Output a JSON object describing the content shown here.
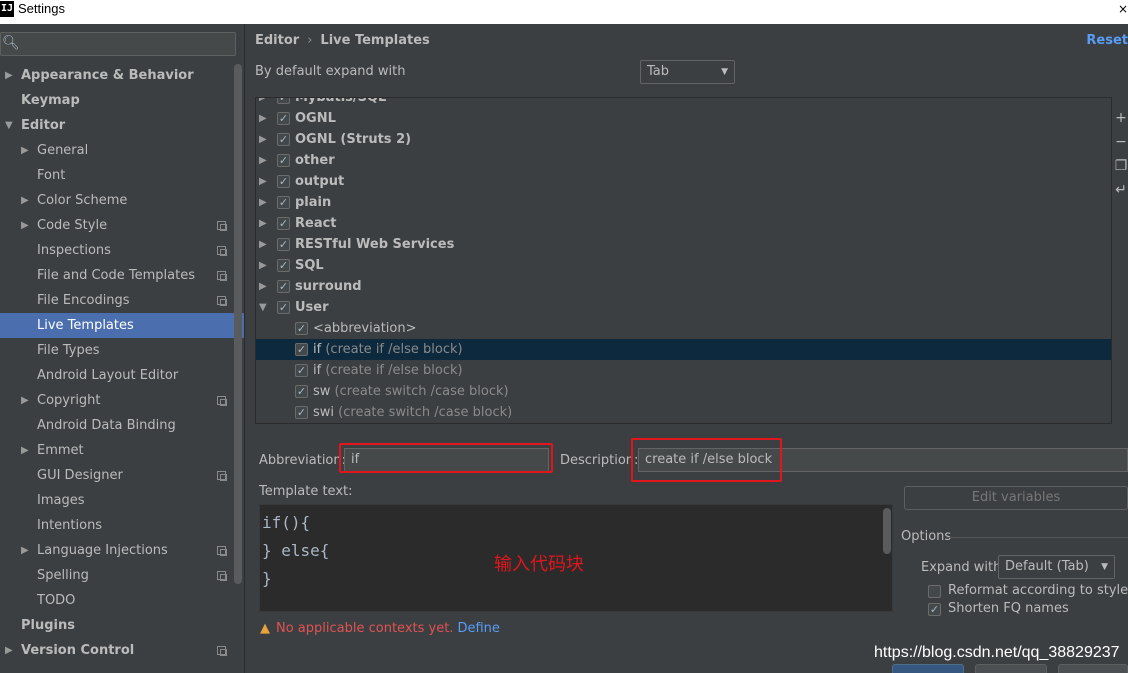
{
  "window": {
    "app_icon": "IJ",
    "title": "Settings",
    "close": "×"
  },
  "search": {
    "placeholder": "",
    "icon": "search-icon"
  },
  "sidebar": {
    "items": [
      {
        "label": "Appearance & Behavior",
        "bold": true,
        "arrow": "▶"
      },
      {
        "label": "Keymap",
        "bold": true,
        "arrow": ""
      },
      {
        "label": "Editor",
        "bold": true,
        "arrow": "▼"
      },
      {
        "label": "General",
        "arrow": "▶"
      },
      {
        "label": "Font",
        "arrow": ""
      },
      {
        "label": "Color Scheme",
        "arrow": "▶"
      },
      {
        "label": "Code Style",
        "arrow": "▶",
        "project": true
      },
      {
        "label": "Inspections",
        "arrow": "",
        "project": true
      },
      {
        "label": "File and Code Templates",
        "arrow": "",
        "project": true
      },
      {
        "label": "File Encodings",
        "arrow": "",
        "project": true
      },
      {
        "label": "Live Templates",
        "arrow": "",
        "selected": true
      },
      {
        "label": "File Types",
        "arrow": ""
      },
      {
        "label": "Android Layout Editor",
        "arrow": ""
      },
      {
        "label": "Copyright",
        "arrow": "▶",
        "project": true
      },
      {
        "label": "Android Data Binding",
        "arrow": ""
      },
      {
        "label": "Emmet",
        "arrow": "▶"
      },
      {
        "label": "GUI Designer",
        "arrow": "",
        "project": true
      },
      {
        "label": "Images",
        "arrow": ""
      },
      {
        "label": "Intentions",
        "arrow": ""
      },
      {
        "label": "Language Injections",
        "arrow": "▶",
        "project": true
      },
      {
        "label": "Spelling",
        "arrow": "",
        "project": true
      },
      {
        "label": "TODO",
        "arrow": ""
      },
      {
        "label": "Plugins",
        "bold": true,
        "arrow": ""
      },
      {
        "label": "Version Control",
        "bold": true,
        "arrow": "▶",
        "project": true
      }
    ]
  },
  "header": {
    "crumb1": "Editor",
    "sep": "›",
    "crumb2": "Live Templates",
    "reset": "Reset"
  },
  "expand": {
    "label": "By default expand with",
    "value": "Tab",
    "caret": "▼"
  },
  "templates": [
    {
      "type": "group",
      "label": "Mybatis/SQL",
      "checked": true
    },
    {
      "type": "group",
      "label": "OGNL",
      "checked": true
    },
    {
      "type": "group",
      "label": "OGNL (Struts 2)",
      "checked": true
    },
    {
      "type": "group",
      "label": "other",
      "checked": true
    },
    {
      "type": "group",
      "label": "output",
      "checked": true
    },
    {
      "type": "group",
      "label": "plain",
      "checked": true
    },
    {
      "type": "group",
      "label": "React",
      "checked": true
    },
    {
      "type": "group",
      "label": "RESTful Web Services",
      "checked": true
    },
    {
      "type": "group",
      "label": "SQL",
      "checked": true
    },
    {
      "type": "group",
      "label": "surround",
      "checked": true
    },
    {
      "type": "group",
      "label": "User",
      "checked": true,
      "expanded": true
    },
    {
      "type": "item",
      "label": "<abbreviation>",
      "desc": "",
      "checked": true
    },
    {
      "type": "item",
      "label": "if",
      "desc": "(create if /else block)",
      "checked": true,
      "selected": true
    },
    {
      "type": "item",
      "label": "if",
      "desc": "(create if /else block)",
      "checked": true
    },
    {
      "type": "item",
      "label": "sw",
      "desc": "(create switch /case block)",
      "checked": true
    },
    {
      "type": "item",
      "label": "swi",
      "desc": "(create switch /case block)",
      "checked": true
    }
  ],
  "tools": {
    "add": "+",
    "remove": "−",
    "copy": "❐",
    "restore": "↵"
  },
  "form": {
    "abbreviation_label": "Abbreviation:",
    "abbreviation_value": "if",
    "description_label": "Description:",
    "description_value": "create if /else block",
    "template_text_label": "Template text:",
    "template_lines": [
      "if(){",
      "} else{",
      "}"
    ],
    "annotation": "输入代码块",
    "edit_variables": "Edit variables",
    "options_title": "Options",
    "expand_with_label": "Expand with",
    "expand_with_value": "Default (Tab)",
    "reformat_label": "Reformat according to style",
    "reformat_checked": false,
    "shorten_label": "Shorten FQ names",
    "shorten_checked": true,
    "warning_icon": "▲",
    "warning_text": "No applicable contexts yet.",
    "define_link": "Define"
  },
  "watermark": "https://blog.csdn.net/qq_38829237",
  "colors": {
    "accent": "#4b6eaf",
    "highlight_box": "#e0161c",
    "link": "#589df6",
    "selected_row": "#0d293e"
  }
}
